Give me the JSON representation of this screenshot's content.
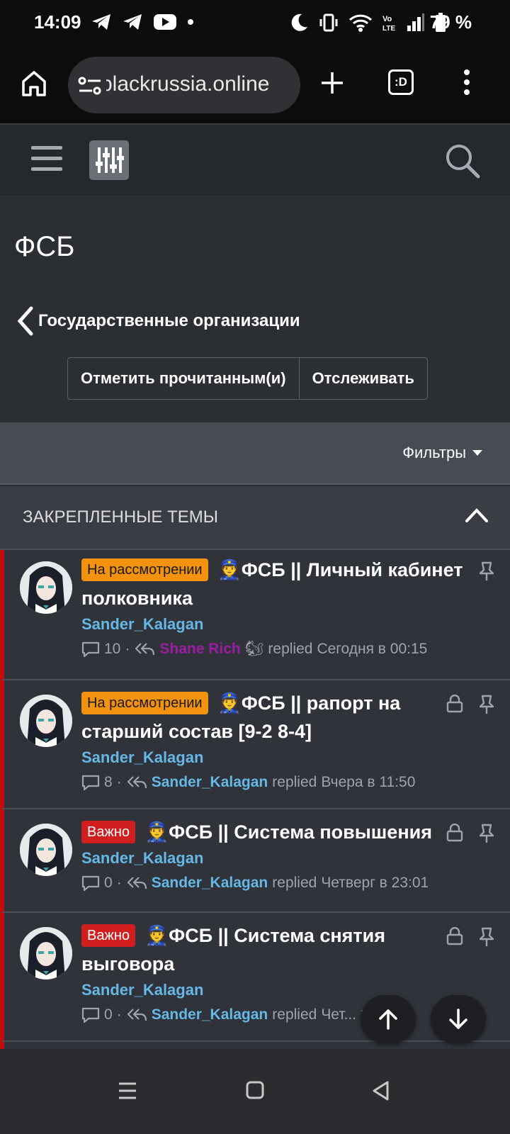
{
  "status_bar": {
    "time": "14:09",
    "battery": "79 %",
    "left_icons": [
      "telegram-icon",
      "telegram-icon",
      "youtube-icon",
      "dot-icon"
    ],
    "right_icons": [
      "moon-icon",
      "vibrate-icon",
      "wifi-icon",
      "volte-icon",
      "signal-icon",
      "battery-icon"
    ]
  },
  "browser": {
    "url": "blackrussia.online",
    "tab_count_label": ":D"
  },
  "page": {
    "title": "ФСБ",
    "breadcrumb": "Государственные организации",
    "mark_read_label": "Отметить прочитанным(и)",
    "watch_label": "Отслеживать",
    "filters_label": "Фильтры",
    "sticky_section_title": "ЗАКРЕПЛЕННЫЕ ТЕМЫ"
  },
  "threads": [
    {
      "badge": "На рассмотрении",
      "badge_color": "#f2920f",
      "emoji": "👮",
      "title": "ФСБ || Личный кабинет полковника",
      "author": "Sander_Kalagan",
      "replies": "10",
      "last_user": "Shane Rich",
      "last_user_emoji": "🐿",
      "replied_label": "replied",
      "last_time": "Сегодня в 00:15",
      "locked": false,
      "pinned": true
    },
    {
      "badge": "На рассмотрении",
      "badge_color": "#f2920f",
      "emoji": "👮",
      "title": "ФСБ || рапорт на старший состав [9-2 8-4]",
      "author": "Sander_Kalagan",
      "replies": "8",
      "last_user": "Sander_Kalagan",
      "last_user_emoji": "",
      "replied_label": "replied",
      "last_time": "Вчера в 11:50",
      "locked": true,
      "pinned": true
    },
    {
      "badge": "Важно",
      "badge_color": "#d11f1f",
      "emoji": "👮",
      "title": "ФСБ || Система повышения",
      "author": "Sander_Kalagan",
      "replies": "0",
      "last_user": "Sander_Kalagan",
      "last_user_emoji": "",
      "replied_label": "replied",
      "last_time": "Четверг в 23:01",
      "locked": true,
      "pinned": true
    },
    {
      "badge": "Важно",
      "badge_color": "#d11f1f",
      "emoji": "👮",
      "title": "ФСБ || Система снятия выговора",
      "author": "Sander_Kalagan",
      "replies": "0",
      "last_user": "Sander_Kalagan",
      "last_user_emoji": "",
      "replied_label": "replied",
      "last_time": "Чет... 22",
      "locked": true,
      "pinned": true
    }
  ],
  "colors": {
    "accent_user": "#65b7e6",
    "purple_user": "#9b1da3",
    "sticky_bar": "#c40c0c"
  }
}
